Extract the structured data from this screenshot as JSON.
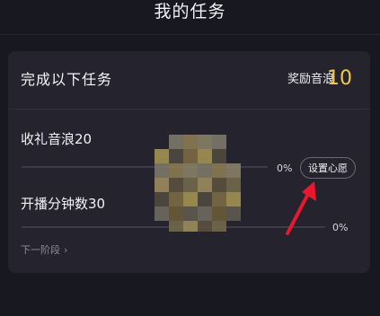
{
  "header": {
    "title": "我的任务"
  },
  "card": {
    "title": "完成以下任务",
    "reward_label": "奖励音浪",
    "reward_value": "10"
  },
  "tasks": [
    {
      "name": "收礼音浪20",
      "progress_text": "0%",
      "progress": 0
    },
    {
      "name": "开播分钟数30",
      "progress_text": "0%",
      "progress": 0
    }
  ],
  "actions": {
    "set_wish_label": "设置心愿",
    "next_stage_label": "下一阶段",
    "next_stage_icon": "chevron-right-icon"
  },
  "annotation": {
    "arrow_color": "#e8182f"
  },
  "colors": {
    "background": "#181821",
    "card": "#24232e",
    "accent_reward": "#f5c84a",
    "progress_fill": "#ff2e5f"
  }
}
